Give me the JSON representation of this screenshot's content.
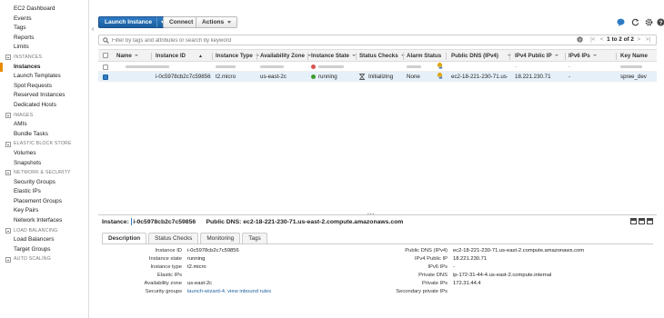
{
  "sidebar": {
    "top_items": [
      "EC2 Dashboard",
      "Events",
      "Tags",
      "Reports",
      "Limits"
    ],
    "sections": [
      {
        "title": "INSTANCES",
        "items": [
          "Instances",
          "Launch Templates",
          "Spot Requests",
          "Reserved Instances",
          "Dedicated Hosts"
        ],
        "active": "Instances"
      },
      {
        "title": "IMAGES",
        "items": [
          "AMIs",
          "Bundle Tasks"
        ]
      },
      {
        "title": "ELASTIC BLOCK STORE",
        "items": [
          "Volumes",
          "Snapshots"
        ]
      },
      {
        "title": "NETWORK & SECURITY",
        "items": [
          "Security Groups",
          "Elastic IPs",
          "Placement Groups",
          "Key Pairs",
          "Network Interfaces"
        ]
      },
      {
        "title": "LOAD BALANCING",
        "items": [
          "Load Balancers",
          "Target Groups"
        ]
      },
      {
        "title": "AUTO SCALING",
        "items": []
      }
    ],
    "collapse_glyph": "‹"
  },
  "toolbar": {
    "launch_label": "Launch Instance",
    "connect_label": "Connect",
    "actions_label": "Actions"
  },
  "search": {
    "placeholder": "Filter by tags and attributes or search by keyword",
    "pager_text": "1 to 2 of 2",
    "pager_first": "|<",
    "pager_prev": "<",
    "pager_next": ">",
    "pager_last": ">|"
  },
  "table": {
    "columns": [
      "Name",
      "Instance ID",
      "Instance Type",
      "Availability Zone",
      "Instance State",
      "Status Checks",
      "Alarm Status",
      "Public DNS (IPv4)",
      "IPv4 Public IP",
      "IPv6 IPs",
      "Key Name"
    ],
    "rows": [
      {
        "selected": true,
        "name": "",
        "instance_id": "i-0c5978cb2c7c59856",
        "instance_type": "t2.micro",
        "availability_zone": "us-east-2c",
        "state": "running",
        "status_checks": "Initializing",
        "alarm_status": "None",
        "public_dns": "ec2-18-221-230-71.us-...",
        "ipv4_public_ip": "18.221.230.71",
        "ipv6": "-",
        "key_name": "spree_dev"
      }
    ]
  },
  "detail": {
    "instance_label": "Instance:",
    "instance_id": "i-0c5978cb2c7c59856",
    "dns_label": "Public DNS:",
    "dns_value": "ec2-18-221-230-71.us-east-2.compute.amazonaws.com",
    "tabs": [
      "Description",
      "Status Checks",
      "Monitoring",
      "Tags"
    ],
    "active_tab": "Description",
    "left": [
      {
        "k": "Instance ID",
        "v": "i-0c5978cb2c7c59856"
      },
      {
        "k": "Instance state",
        "v": "running"
      },
      {
        "k": "Instance type",
        "v": "t2.micro"
      },
      {
        "k": "Elastic IPs",
        "v": ""
      },
      {
        "k": "Availability zone",
        "v": "us-east-2c"
      },
      {
        "k": "Security groups",
        "v": "launch-wizard-4.",
        "link2": "view inbound rules"
      }
    ],
    "right": [
      {
        "k": "Public DNS (IPv4)",
        "v": "ec2-18-221-230-71.us-east-2.compute.amazonaws.com"
      },
      {
        "k": "IPv4 Public IP",
        "v": "18.221.230.71"
      },
      {
        "k": "IPv6 IPs",
        "v": "-"
      },
      {
        "k": "Private DNS",
        "v": "ip-172-31-44-4.us-east-2.compute.internal"
      },
      {
        "k": "Private IPs",
        "v": "172.31.44.4"
      },
      {
        "k": "Secondary private IPs",
        "v": ""
      }
    ]
  },
  "colors": {
    "accent": "#2e7bc4",
    "running": "#3c9c2c",
    "stopped": "#d9534f",
    "active_marker": "#e88b00"
  }
}
